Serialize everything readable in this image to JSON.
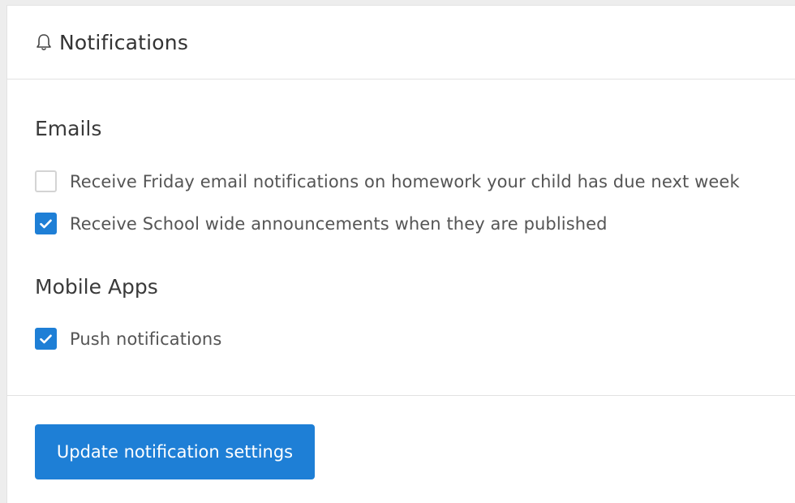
{
  "header": {
    "icon": "bell-icon",
    "title": "Notifications"
  },
  "emails": {
    "title": "Emails",
    "options": [
      {
        "label": "Receive Friday email notifications on homework your child has due next week",
        "checked": false
      },
      {
        "label": "Receive School wide announcements when they are published",
        "checked": true
      }
    ]
  },
  "mobile": {
    "title": "Mobile Apps",
    "options": [
      {
        "label": "Push notifications",
        "checked": true
      }
    ]
  },
  "footer": {
    "update_label": "Update notification settings"
  },
  "colors": {
    "accent": "#1e7fd6",
    "background": "#ededed"
  }
}
